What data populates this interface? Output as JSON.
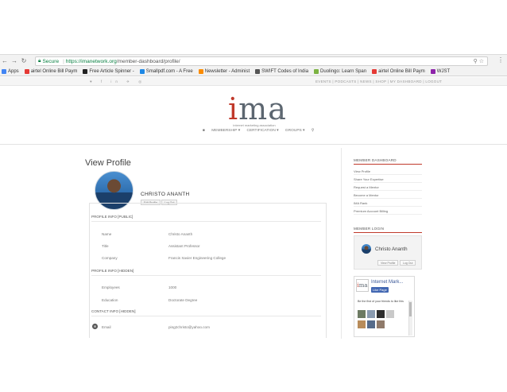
{
  "browser": {
    "secure_label": "Secure",
    "url_host": "https://imanetwork.org",
    "url_path": "/member-dashboard/profile/",
    "bookmarks": [
      {
        "label": "Apps",
        "color": "#4285f4"
      },
      {
        "label": "airtel Online Bill Paym",
        "color": "#e53935"
      },
      {
        "label": "Free Article Spinner -",
        "color": "#222222"
      },
      {
        "label": "Smallpdf.com - A Free",
        "color": "#1e88e5"
      },
      {
        "label": "Newsletter - Administ",
        "color": "#fb8c00"
      },
      {
        "label": "SWIFT Codes of India",
        "color": "#555555"
      },
      {
        "label": "Duolingo: Learn Span",
        "color": "#7cb342"
      },
      {
        "label": "airtel Online Bill Paym",
        "color": "#e53935"
      },
      {
        "label": "WJST",
        "color": "#8e24aa"
      }
    ]
  },
  "site": {
    "social": "♥ f in ✈ ◎",
    "top_links": "EVENTS | PODCASTS | NEWS | SHOP | MY DASHBOARD | LOGOUT",
    "logo_i": "i",
    "logo_rest": "ma",
    "logo_tm": "™",
    "logo_sub": "internet marketing association",
    "nav": [
      "■",
      "MEMBERSHIP ▾",
      "CERTIFICATION ▾",
      "GROUPS ▾",
      "⚲"
    ]
  },
  "profile": {
    "page_title": "View Profile",
    "name": "CHRISTO ANANTH",
    "edit_btn": "Edit Profile",
    "logout_btn": "Log Out",
    "sections": {
      "public": "PROFILE INFO [PUBLIC]",
      "hidden": "PROFILE INFO [HIDDEN]",
      "contact": "CONTACT INFO [HIDDEN]"
    },
    "public_fields": [
      {
        "label": "Name",
        "value": "Christo Ananth"
      },
      {
        "label": "Title",
        "value": "Assistant Professor"
      },
      {
        "label": "Company",
        "value": "Francis Xavier Engineering College"
      }
    ],
    "hidden_fields": [
      {
        "label": "Employees",
        "value": "1000"
      },
      {
        "label": "Education",
        "value": "Doctorate Degree"
      }
    ],
    "contact_fields": [
      {
        "label": "Email",
        "value": "ping2christo@yahoo.com"
      }
    ]
  },
  "sidebar": {
    "dashboard_head": "MEMBER DASHBOARD",
    "links": [
      "View Profile",
      "Share Your Expertise",
      "Request a Mentor",
      "Become a Mentor",
      "IMA Rank",
      "Premium Account Billing"
    ],
    "login_head": "MEMBER LOGIN",
    "login_name": "Christo Ananth",
    "view_profile_btn": "View Profile",
    "logout_btn": "Log Out",
    "fb_logo_i": "i",
    "fb_logo_rest": "ma",
    "fb_title": "Internet Mark...",
    "fb_like": "Like Page",
    "fb_text": "Be the first of your friends to like this"
  }
}
